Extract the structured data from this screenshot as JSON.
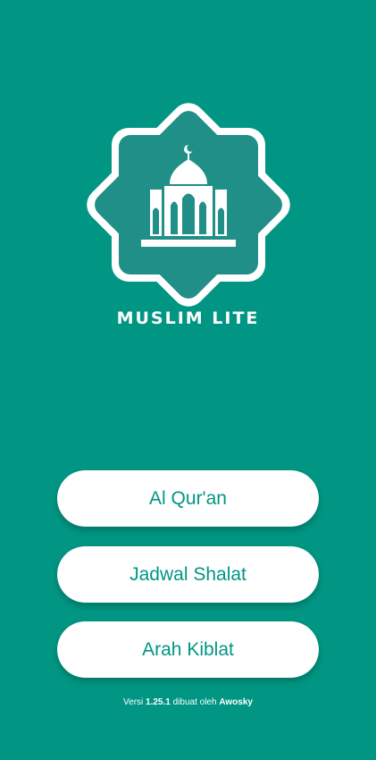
{
  "app": {
    "name": "MUSLIM LITE"
  },
  "menu": {
    "items": [
      {
        "label": "Al Qur'an"
      },
      {
        "label": "Jadwal Shalat"
      },
      {
        "label": "Arah Kiblat"
      }
    ]
  },
  "footer": {
    "prefix": "Versi",
    "version": "1.25.1",
    "middle": "dibuat oleh",
    "author": "Awosky"
  },
  "colors": {
    "background": "#009683",
    "button_background": "#ffffff",
    "button_text": "#009683",
    "logo_fill": "#1f8f88"
  },
  "icons": {
    "logo": "mosque-icon"
  }
}
